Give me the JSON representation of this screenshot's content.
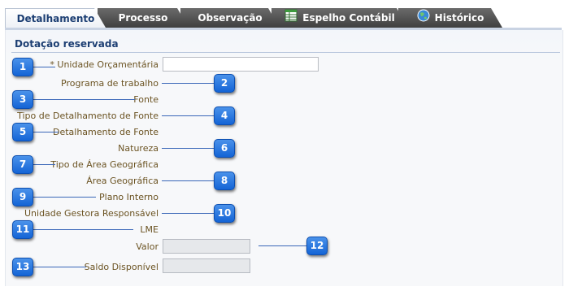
{
  "tabs": [
    {
      "label": "Detalhamento",
      "active": true,
      "icon": ""
    },
    {
      "label": "Processo",
      "active": false,
      "icon": ""
    },
    {
      "label": "Observação",
      "active": false,
      "icon": ""
    },
    {
      "label": "Espelho Contábil",
      "active": false,
      "icon": "spreadsheet-icon"
    },
    {
      "label": "Histórico",
      "active": false,
      "icon": "globe-icon"
    }
  ],
  "section": {
    "title": "Dotação reservada"
  },
  "fields": [
    {
      "label": "* Unidade Orçamentária",
      "badge": "1",
      "has_input": true,
      "disabled": false
    },
    {
      "label": "Programa de trabalho",
      "badge": "2",
      "has_input": false
    },
    {
      "label": "Fonte",
      "badge": "3",
      "has_input": false
    },
    {
      "label": "Tipo de Detalhamento de Fonte",
      "badge": "4",
      "has_input": false
    },
    {
      "label": "Detalhamento de Fonte",
      "badge": "5",
      "has_input": false
    },
    {
      "label": "Natureza",
      "badge": "6",
      "has_input": false
    },
    {
      "label": "Tipo de Área Geográfica",
      "badge": "7",
      "has_input": false
    },
    {
      "label": "Área Geográfica",
      "badge": "8",
      "has_input": false
    },
    {
      "label": "Plano Interno",
      "badge": "9",
      "has_input": false
    },
    {
      "label": "Unidade Gestora Responsável",
      "badge": "10",
      "has_input": false
    },
    {
      "label": "LME",
      "badge": "11",
      "has_input": false
    },
    {
      "label": "Valor",
      "badge": "12",
      "has_input": true,
      "disabled": true
    },
    {
      "label": "Saldo Disponível",
      "badge": "13",
      "has_input": true,
      "disabled": true
    }
  ],
  "colors": {
    "badge": "#1f6fe0",
    "label_text": "#6b5322",
    "section_title": "#1d3f73",
    "tab_inactive": "#4f4f4f"
  }
}
